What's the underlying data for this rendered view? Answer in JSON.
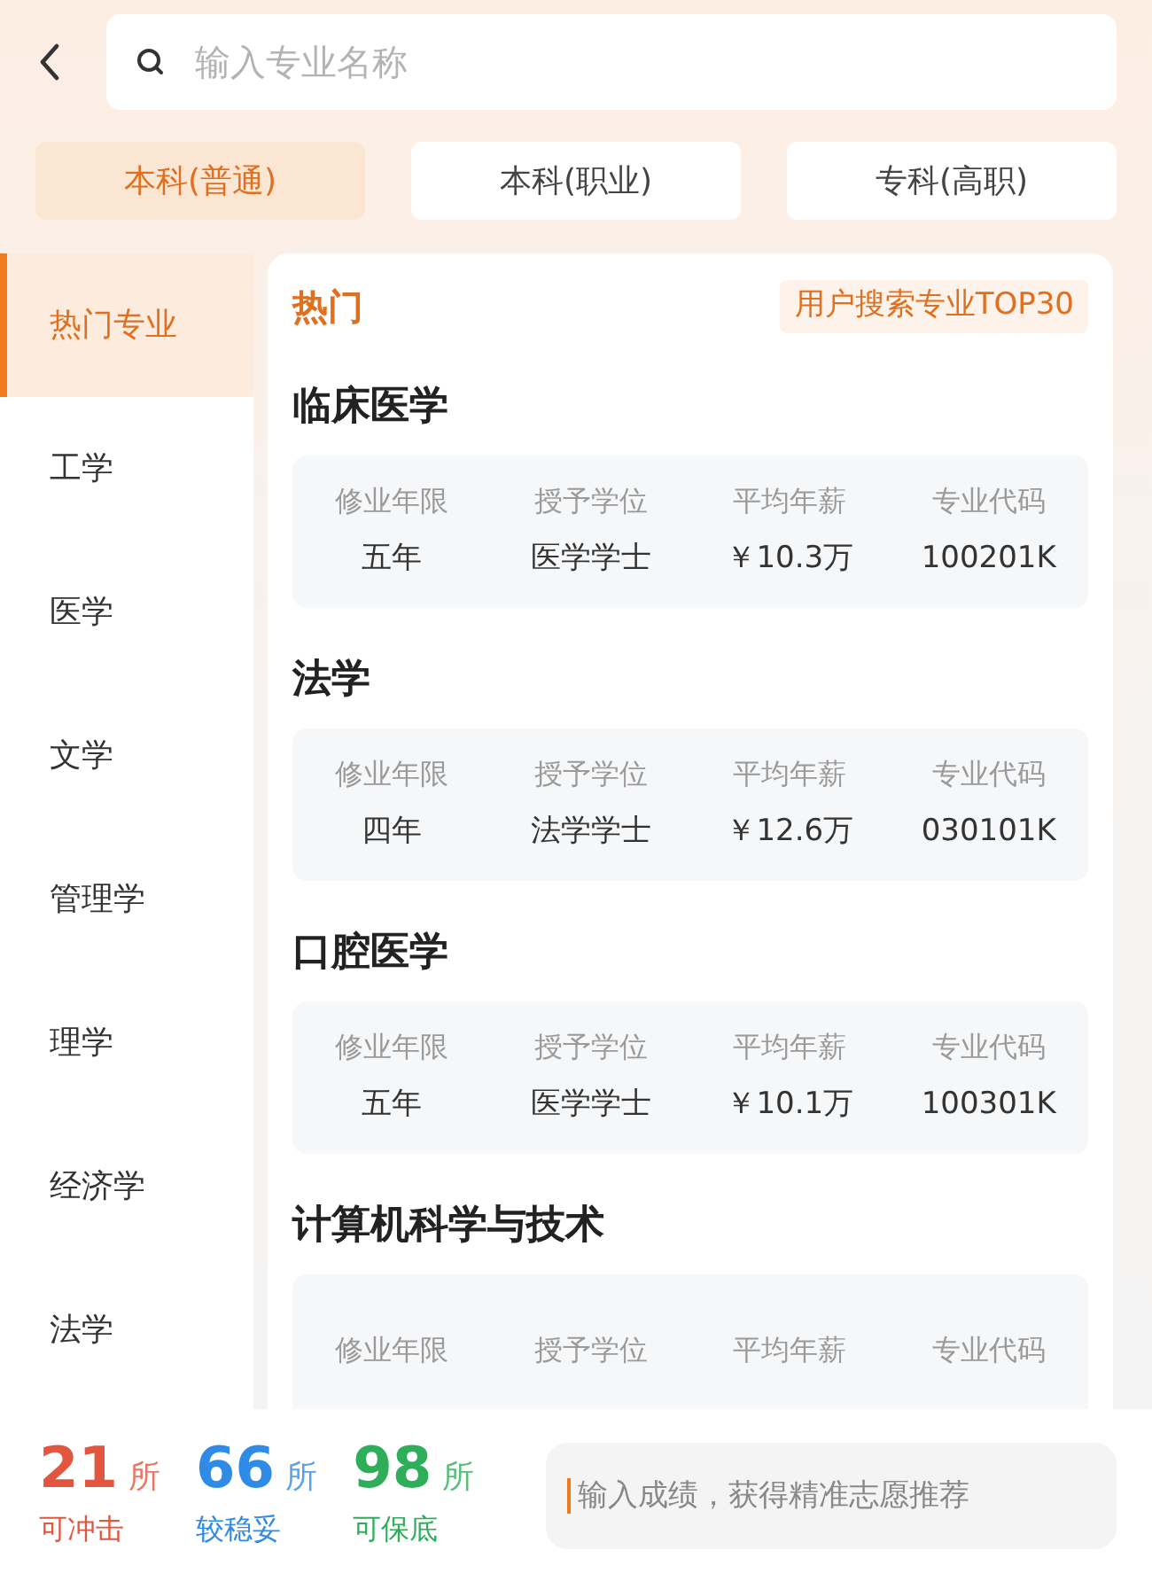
{
  "search": {
    "placeholder": "输入专业名称"
  },
  "levels": [
    {
      "label": "本科(普通)",
      "selected": true
    },
    {
      "label": "本科(职业)",
      "selected": false
    },
    {
      "label": "专科(高职)",
      "selected": false
    }
  ],
  "categories": [
    {
      "label": "热门专业",
      "selected": true
    },
    {
      "label": "工学",
      "selected": false
    },
    {
      "label": "医学",
      "selected": false
    },
    {
      "label": "文学",
      "selected": false
    },
    {
      "label": "管理学",
      "selected": false
    },
    {
      "label": "理学",
      "selected": false
    },
    {
      "label": "经济学",
      "selected": false
    },
    {
      "label": "法学",
      "selected": false
    }
  ],
  "section": {
    "title": "热门",
    "badge": "用户搜索专业TOP30"
  },
  "majors": [
    {
      "name": "临床医学",
      "fields": [
        {
          "label": "修业年限",
          "value": "五年"
        },
        {
          "label": "授予学位",
          "value": "医学学士"
        },
        {
          "label": "平均年薪",
          "value": "￥10.3万"
        },
        {
          "label": "专业代码",
          "value": "100201K"
        }
      ]
    },
    {
      "name": "法学",
      "fields": [
        {
          "label": "修业年限",
          "value": "四年"
        },
        {
          "label": "授予学位",
          "value": "法学学士"
        },
        {
          "label": "平均年薪",
          "value": "￥12.6万"
        },
        {
          "label": "专业代码",
          "value": "030101K"
        }
      ]
    },
    {
      "name": "口腔医学",
      "fields": [
        {
          "label": "修业年限",
          "value": "五年"
        },
        {
          "label": "授予学位",
          "value": "医学学士"
        },
        {
          "label": "平均年薪",
          "value": "￥10.1万"
        },
        {
          "label": "专业代码",
          "value": "100301K"
        }
      ]
    },
    {
      "name": "计算机科学与技术",
      "fields": [
        {
          "label": "修业年限"
        },
        {
          "label": "授予学位"
        },
        {
          "label": "平均年薪"
        },
        {
          "label": "专业代码"
        }
      ]
    }
  ],
  "summary": [
    {
      "kind": "reach",
      "count": "21",
      "unit": "所",
      "label": "可冲击"
    },
    {
      "kind": "match",
      "count": "66",
      "unit": "所",
      "label": "较稳妥"
    },
    {
      "kind": "safe",
      "count": "98",
      "unit": "所",
      "label": "可保底"
    }
  ],
  "score_input": {
    "placeholder": "输入成绩，获得精准志愿推荐"
  }
}
